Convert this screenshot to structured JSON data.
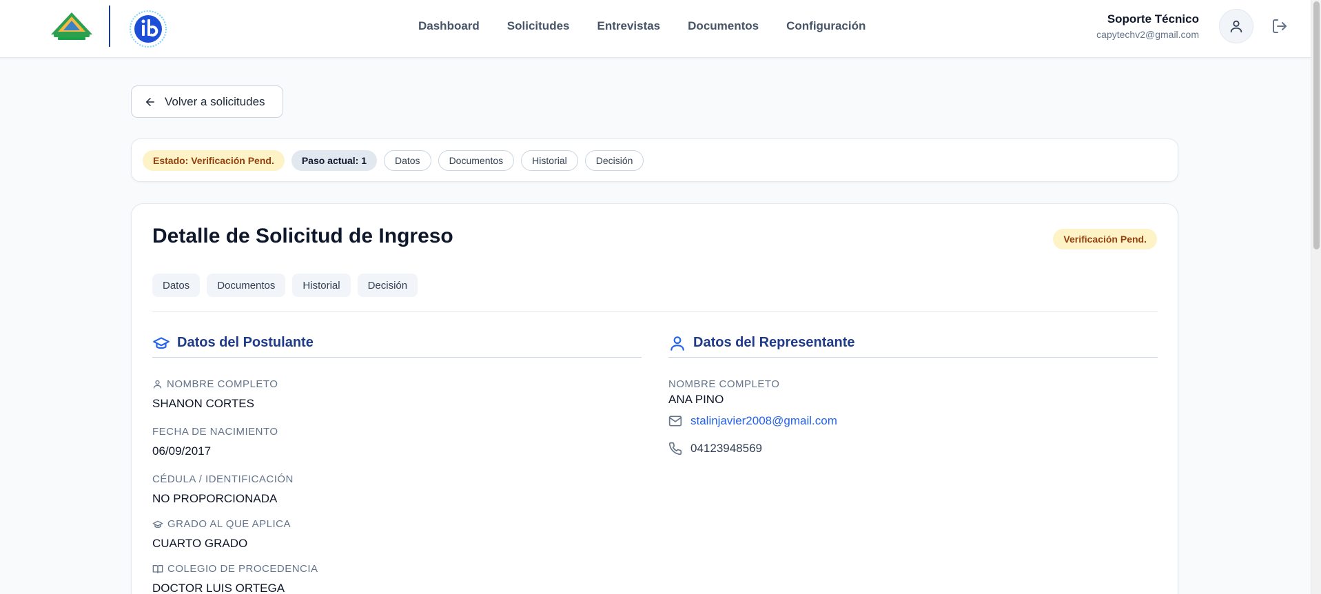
{
  "header": {
    "school_logo": "colegio-guayamuri-logo",
    "ib_logo": "ib-logo",
    "nav": [
      "Dashboard",
      "Solicitudes",
      "Entrevistas",
      "Documentos",
      "Configuración"
    ],
    "user_name": "Soporte Técnico",
    "user_email": "capytechv2@gmail.com",
    "icons": {
      "avatar": "user-icon",
      "logout": "logout-icon"
    }
  },
  "back_button": {
    "label": "Volver a solicitudes",
    "icon": "arrow-left-icon"
  },
  "status_bar": {
    "estado": "Estado: Verificación Pend.",
    "paso": "Paso actual: 1",
    "links": [
      "Datos",
      "Documentos",
      "Historial",
      "Decisión"
    ]
  },
  "detail": {
    "title": "Detalle de Solicitud de Ingreso",
    "badge": "Verificación Pend.",
    "tabs": [
      "Datos",
      "Documentos",
      "Historial",
      "Decisión"
    ],
    "postulante": {
      "heading": "Datos del Postulante",
      "icon": "graduation-cap-icon",
      "fields": [
        {
          "label": "NOMBRE COMPLETO",
          "value": "SHANON CORTES",
          "icon": "user-icon"
        },
        {
          "label": "FECHA DE NACIMIENTO",
          "value": "06/09/2017",
          "icon": ""
        },
        {
          "label": "CÉDULA / IDENTIFICACIÓN",
          "value": "NO PROPORCIONADA",
          "icon": ""
        },
        {
          "label": "GRADO AL QUE APLICA",
          "value": "CUARTO GRADO",
          "icon": "graduation-cap-icon"
        },
        {
          "label": "COLEGIO DE PROCEDENCIA",
          "value": "DOCTOR LUIS ORTEGA",
          "icon": "book-icon"
        }
      ]
    },
    "representante": {
      "heading": "Datos del Representante",
      "icon": "user-icon",
      "name_label": "NOMBRE COMPLETO",
      "name": "ANA PINO",
      "email": "stalinjavier2008@gmail.com",
      "phone": "04123948569",
      "email_icon": "mail-icon",
      "phone_icon": "phone-icon"
    }
  },
  "colors": {
    "primary": "#1e3a8a",
    "link": "#2563eb",
    "warning_bg": "#fef3c7",
    "warning_text": "#92400e",
    "muted": "#64748b"
  }
}
